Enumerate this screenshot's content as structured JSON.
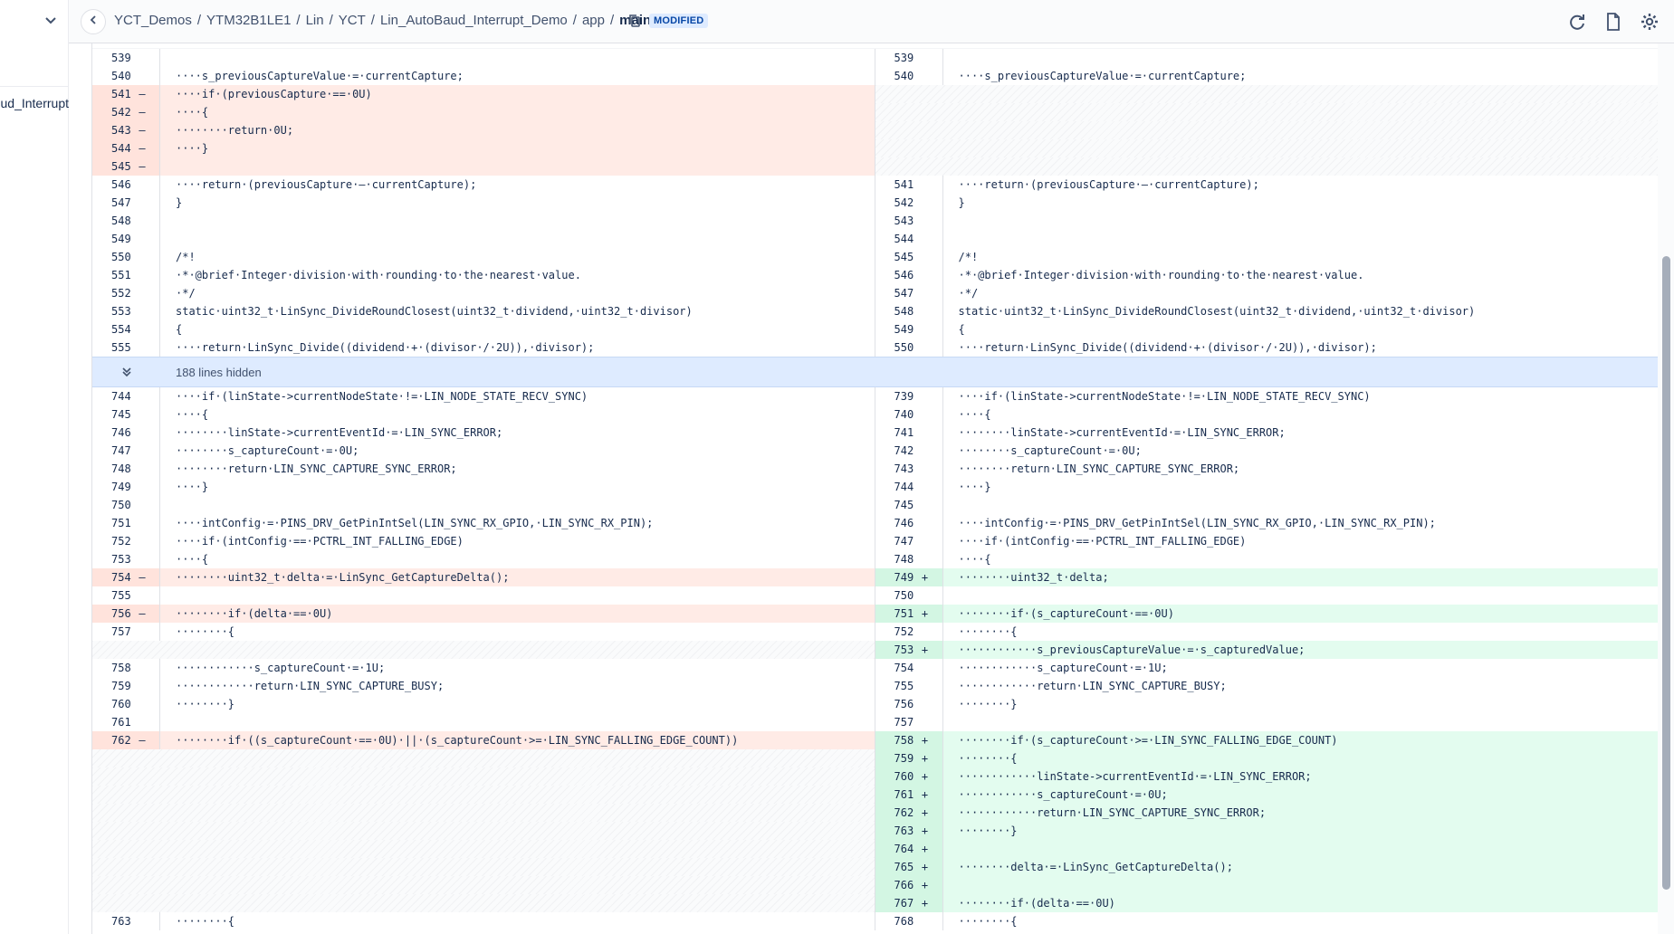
{
  "sidebar": {
    "file_label": "ud_Interrupt"
  },
  "header": {
    "breadcrumb": [
      "YCT_Demos",
      "YTM32B1LE1",
      "Lin",
      "YCT",
      "Lin_AutoBaud_Interrupt_Demo",
      "app"
    ],
    "filename": "main.c",
    "sep": "/",
    "badge": "MODIFIED"
  },
  "diff": {
    "hidden_label": "188 lines hidden",
    "before_hidden": [
      {
        "l": [
          "539",
          ""
        ],
        "r": [
          "539",
          ""
        ],
        "type": "ctx",
        "lc": "",
        "rc": ""
      },
      {
        "l": [
          "540",
          ""
        ],
        "r": [
          "540",
          ""
        ],
        "type": "ctx",
        "lc": "····s_previousCaptureValue·=·currentCapture;",
        "rc": "····s_previousCaptureValue·=·currentCapture;"
      },
      {
        "l": [
          "541",
          "–"
        ],
        "r": [
          "",
          ""
        ],
        "type": "del",
        "lc": "····if·(previousCapture·==·0U)",
        "rc": ""
      },
      {
        "l": [
          "542",
          "–"
        ],
        "r": [
          "",
          ""
        ],
        "type": "del",
        "lc": "····{",
        "rc": ""
      },
      {
        "l": [
          "543",
          "–"
        ],
        "r": [
          "",
          ""
        ],
        "type": "del",
        "lc": "········return·0U;",
        "rc": ""
      },
      {
        "l": [
          "544",
          "–"
        ],
        "r": [
          "",
          ""
        ],
        "type": "del",
        "lc": "····}",
        "rc": ""
      },
      {
        "l": [
          "545",
          "–"
        ],
        "r": [
          "",
          ""
        ],
        "type": "del",
        "lc": "",
        "rc": ""
      },
      {
        "l": [
          "546",
          ""
        ],
        "r": [
          "541",
          ""
        ],
        "type": "ctx",
        "lc": "····return·(previousCapture·–·currentCapture);",
        "rc": "····return·(previousCapture·–·currentCapture);"
      },
      {
        "l": [
          "547",
          ""
        ],
        "r": [
          "542",
          ""
        ],
        "type": "ctx",
        "lc": "}",
        "rc": "}"
      },
      {
        "l": [
          "548",
          ""
        ],
        "r": [
          "543",
          ""
        ],
        "type": "ctx",
        "lc": "",
        "rc": ""
      },
      {
        "l": [
          "549",
          ""
        ],
        "r": [
          "544",
          ""
        ],
        "type": "ctx",
        "lc": "",
        "rc": ""
      },
      {
        "l": [
          "550",
          ""
        ],
        "r": [
          "545",
          ""
        ],
        "type": "ctx",
        "lc": "/*!",
        "rc": "/*!"
      },
      {
        "l": [
          "551",
          ""
        ],
        "r": [
          "546",
          ""
        ],
        "type": "ctx",
        "lc": "·*·@brief·Integer·division·with·rounding·to·the·nearest·value.",
        "rc": "·*·@brief·Integer·division·with·rounding·to·the·nearest·value."
      },
      {
        "l": [
          "552",
          ""
        ],
        "r": [
          "547",
          ""
        ],
        "type": "ctx",
        "lc": "·*/",
        "rc": "·*/"
      },
      {
        "l": [
          "553",
          ""
        ],
        "r": [
          "548",
          ""
        ],
        "type": "ctx",
        "lc": "static·uint32_t·LinSync_DivideRoundClosest(uint32_t·dividend,·uint32_t·divisor)",
        "rc": "static·uint32_t·LinSync_DivideRoundClosest(uint32_t·dividend,·uint32_t·divisor)"
      },
      {
        "l": [
          "554",
          ""
        ],
        "r": [
          "549",
          ""
        ],
        "type": "ctx",
        "lc": "{",
        "rc": "{"
      },
      {
        "l": [
          "555",
          ""
        ],
        "r": [
          "550",
          ""
        ],
        "type": "ctx",
        "lc": "····return·LinSync_Divide((dividend·+·(divisor·/·2U)),·divisor);",
        "rc": "····return·LinSync_Divide((dividend·+·(divisor·/·2U)),·divisor);"
      }
    ],
    "after_hidden": [
      {
        "l": [
          "744",
          ""
        ],
        "r": [
          "739",
          ""
        ],
        "type": "ctx",
        "lc": "····if·(linState->currentNodeState·!=·LIN_NODE_STATE_RECV_SYNC)",
        "rc": "····if·(linState->currentNodeState·!=·LIN_NODE_STATE_RECV_SYNC)"
      },
      {
        "l": [
          "745",
          ""
        ],
        "r": [
          "740",
          ""
        ],
        "type": "ctx",
        "lc": "····{",
        "rc": "····{"
      },
      {
        "l": [
          "746",
          ""
        ],
        "r": [
          "741",
          ""
        ],
        "type": "ctx",
        "lc": "········linState->currentEventId·=·LIN_SYNC_ERROR;",
        "rc": "········linState->currentEventId·=·LIN_SYNC_ERROR;"
      },
      {
        "l": [
          "747",
          ""
        ],
        "r": [
          "742",
          ""
        ],
        "type": "ctx",
        "lc": "········s_captureCount·=·0U;",
        "rc": "········s_captureCount·=·0U;"
      },
      {
        "l": [
          "748",
          ""
        ],
        "r": [
          "743",
          ""
        ],
        "type": "ctx",
        "lc": "········return·LIN_SYNC_CAPTURE_SYNC_ERROR;",
        "rc": "········return·LIN_SYNC_CAPTURE_SYNC_ERROR;"
      },
      {
        "l": [
          "749",
          ""
        ],
        "r": [
          "744",
          ""
        ],
        "type": "ctx",
        "lc": "····}",
        "rc": "····}"
      },
      {
        "l": [
          "750",
          ""
        ],
        "r": [
          "745",
          ""
        ],
        "type": "ctx",
        "lc": "",
        "rc": ""
      },
      {
        "l": [
          "751",
          ""
        ],
        "r": [
          "746",
          ""
        ],
        "type": "ctx",
        "lc": "····intConfig·=·PINS_DRV_GetPinIntSel(LIN_SYNC_RX_GPIO,·LIN_SYNC_RX_PIN);",
        "rc": "····intConfig·=·PINS_DRV_GetPinIntSel(LIN_SYNC_RX_GPIO,·LIN_SYNC_RX_PIN);"
      },
      {
        "l": [
          "752",
          ""
        ],
        "r": [
          "747",
          ""
        ],
        "type": "ctx",
        "lc": "····if·(intConfig·==·PCTRL_INT_FALLING_EDGE)",
        "rc": "····if·(intConfig·==·PCTRL_INT_FALLING_EDGE)"
      },
      {
        "l": [
          "753",
          ""
        ],
        "r": [
          "748",
          ""
        ],
        "type": "ctx",
        "lc": "····{",
        "rc": "····{"
      },
      {
        "l": [
          "754",
          "–"
        ],
        "r": [
          "749",
          "+"
        ],
        "type": "chg",
        "lc": "········uint32_t·delta·=·LinSync_GetCaptureDelta();",
        "rc": "········uint32_t·delta;"
      },
      {
        "l": [
          "755",
          ""
        ],
        "r": [
          "750",
          ""
        ],
        "type": "ctx",
        "lc": "",
        "rc": ""
      },
      {
        "l": [
          "756",
          "–"
        ],
        "r": [
          "751",
          "+"
        ],
        "type": "chg",
        "lc": "········if·(delta·==·0U)",
        "rc": "········if·(s_captureCount·==·0U)"
      },
      {
        "l": [
          "757",
          ""
        ],
        "r": [
          "752",
          ""
        ],
        "type": "ctx",
        "lc": "········{",
        "rc": "········{"
      },
      {
        "l": [
          "",
          ""
        ],
        "r": [
          "753",
          "+"
        ],
        "type": "add",
        "lc": "",
        "rc": "············s_previousCaptureValue·=·s_capturedValue;"
      },
      {
        "l": [
          "758",
          ""
        ],
        "r": [
          "754",
          ""
        ],
        "type": "ctx",
        "lc": "············s_captureCount·=·1U;",
        "rc": "············s_captureCount·=·1U;"
      },
      {
        "l": [
          "759",
          ""
        ],
        "r": [
          "755",
          ""
        ],
        "type": "ctx",
        "lc": "············return·LIN_SYNC_CAPTURE_BUSY;",
        "rc": "············return·LIN_SYNC_CAPTURE_BUSY;"
      },
      {
        "l": [
          "760",
          ""
        ],
        "r": [
          "756",
          ""
        ],
        "type": "ctx",
        "lc": "········}",
        "rc": "········}"
      },
      {
        "l": [
          "761",
          ""
        ],
        "r": [
          "757",
          ""
        ],
        "type": "ctx",
        "lc": "",
        "rc": ""
      },
      {
        "l": [
          "762",
          "–"
        ],
        "r": [
          "758",
          "+"
        ],
        "type": "chg",
        "lc": "········if·((s_captureCount·==·0U)·||·(s_captureCount·>=·LIN_SYNC_FALLING_EDGE_COUNT))",
        "rc": "········if·(s_captureCount·>=·LIN_SYNC_FALLING_EDGE_COUNT)"
      },
      {
        "l": [
          "",
          ""
        ],
        "r": [
          "759",
          "+"
        ],
        "type": "add",
        "lc": "",
        "rc": "········{"
      },
      {
        "l": [
          "",
          ""
        ],
        "r": [
          "760",
          "+"
        ],
        "type": "add",
        "lc": "",
        "rc": "············linState->currentEventId·=·LIN_SYNC_ERROR;"
      },
      {
        "l": [
          "",
          ""
        ],
        "r": [
          "761",
          "+"
        ],
        "type": "add",
        "lc": "",
        "rc": "············s_captureCount·=·0U;"
      },
      {
        "l": [
          "",
          ""
        ],
        "r": [
          "762",
          "+"
        ],
        "type": "add",
        "lc": "",
        "rc": "············return·LIN_SYNC_CAPTURE_SYNC_ERROR;"
      },
      {
        "l": [
          "",
          ""
        ],
        "r": [
          "763",
          "+"
        ],
        "type": "add",
        "lc": "",
        "rc": "········}"
      },
      {
        "l": [
          "",
          ""
        ],
        "r": [
          "764",
          "+"
        ],
        "type": "add",
        "lc": "",
        "rc": ""
      },
      {
        "l": [
          "",
          ""
        ],
        "r": [
          "765",
          "+"
        ],
        "type": "add",
        "lc": "",
        "rc": "········delta·=·LinSync_GetCaptureDelta();"
      },
      {
        "l": [
          "",
          ""
        ],
        "r": [
          "766",
          "+"
        ],
        "type": "add",
        "lc": "",
        "rc": ""
      },
      {
        "l": [
          "",
          ""
        ],
        "r": [
          "767",
          "+"
        ],
        "type": "add",
        "lc": "",
        "rc": "········if·(delta·==·0U)"
      },
      {
        "l": [
          "763",
          ""
        ],
        "r": [
          "768",
          ""
        ],
        "type": "ctx",
        "lc": "········{",
        "rc": "········{"
      }
    ]
  },
  "colors": {
    "deleted_bg": "#ffebe6",
    "added_bg": "#e3fcef",
    "hidden_bar_bg": "#deebff",
    "badge_text": "#0747a6"
  },
  "icons": [
    "chevron-down-icon",
    "back-arrow-icon",
    "copy-icon",
    "refresh-icon",
    "file-icon",
    "settings-gear-icon",
    "expand-icon"
  ]
}
